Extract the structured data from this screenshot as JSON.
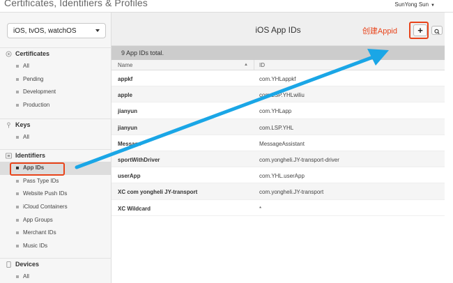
{
  "app_title": "Certificates, Identifiers & Profiles",
  "user": {
    "name": "SunYong Sun"
  },
  "platform_select": {
    "value": "iOS, tvOS, watchOS"
  },
  "sidebar": {
    "certificates": {
      "title": "Certificates",
      "items": [
        "All",
        "Pending",
        "Development",
        "Production"
      ]
    },
    "keys": {
      "title": "Keys",
      "items": [
        "All"
      ]
    },
    "identifiers": {
      "title": "Identifiers",
      "items": [
        "App IDs",
        "Pass Type IDs",
        "Website Push IDs",
        "iCloud Containers",
        "App Groups",
        "Merchant IDs",
        "Music IDs"
      ]
    },
    "devices": {
      "title": "Devices",
      "items": [
        "All"
      ]
    }
  },
  "main": {
    "title": "iOS App IDs",
    "annotation": "创建Appid",
    "add_label": "+",
    "total": "9  App IDs total.",
    "columns": {
      "name": "Name",
      "id": "ID"
    },
    "rows": [
      {
        "name": "appkf",
        "id": "com.YHLappkf"
      },
      {
        "name": "apple",
        "id": "com.LSP.YHLwiliu"
      },
      {
        "name": "jianyun",
        "id": "com.YHLapp"
      },
      {
        "name": "jianyun",
        "id": "com.LSP.YHL"
      },
      {
        "name": "Message",
        "id": "MessageAssistant"
      },
      {
        "name": "sportWithDriver",
        "id": "com.yongheli.JY-transport-driver"
      },
      {
        "name": "userApp",
        "id": "com.YHL.userApp"
      },
      {
        "name": "XC com yongheli JY-transport",
        "id": "com.yongheli.JY-transport"
      },
      {
        "name": "XC Wildcard",
        "id": "*"
      }
    ]
  },
  "colors": {
    "annotation": "#e8431a",
    "arrow": "#1aa6e6"
  }
}
